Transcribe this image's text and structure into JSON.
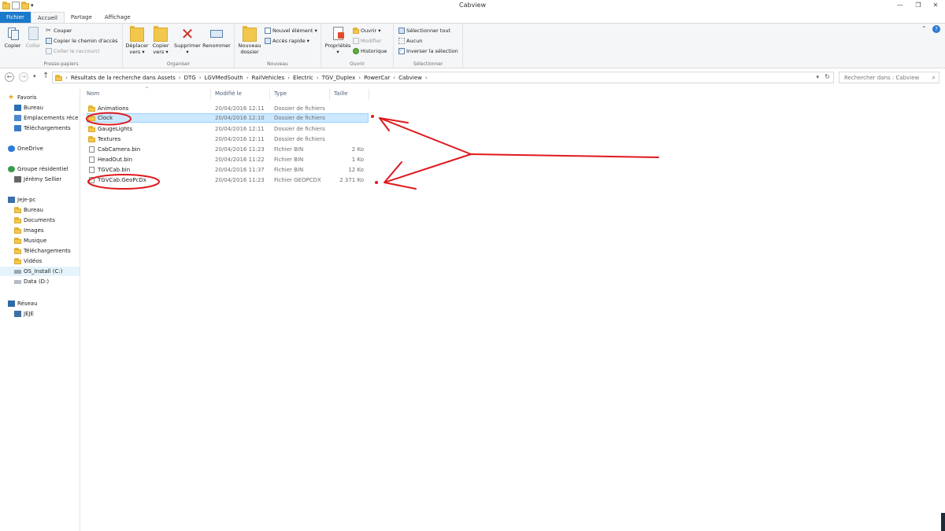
{
  "window": {
    "title": "Cabview"
  },
  "tabs": [
    {
      "label": "Fichier"
    },
    {
      "label": "Accueil"
    },
    {
      "label": "Partage"
    },
    {
      "label": "Affichage"
    }
  ],
  "ribbon": {
    "clipboard": {
      "label": "Presse-papiers",
      "copy": "Copier",
      "paste": "Coller",
      "cut": "Couper",
      "copy_path": "Copier le chemin d'accès",
      "paste_shortcut": "Coller le raccourci"
    },
    "organize": {
      "label": "Organiser",
      "move_to_line1": "Déplacer",
      "move_to_line2": "vers",
      "copy_to_line1": "Copier",
      "copy_to_line2": "vers",
      "delete": "Supprimer",
      "rename": "Renommer"
    },
    "new": {
      "label": "Nouveau",
      "new_folder_line1": "Nouveau",
      "new_folder_line2": "dossier",
      "new_item": "Nouvel élément",
      "easy_access": "Accès rapide"
    },
    "open": {
      "label": "Ouvrir",
      "properties": "Propriétés",
      "open": "Ouvrir",
      "edit": "Modifier",
      "history": "Historique"
    },
    "select": {
      "label": "Sélectionner",
      "select_all": "Sélectionner tout",
      "select_none": "Aucun",
      "invert": "Inverser la sélection"
    }
  },
  "address": {
    "crumbs": [
      "Résultats de la recherche dans Assets",
      "DTG",
      "LGVMedSouth",
      "RailVehicles",
      "Electric",
      "TGV_Duplex",
      "PowerCar",
      "Cabview"
    ],
    "search_placeholder": "Rechercher dans : Cabview"
  },
  "nav": {
    "favorites": "Favoris",
    "fav_items": [
      "Bureau",
      "Emplacements récents",
      "Téléchargements"
    ],
    "onedrive": "OneDrive",
    "homegroup": "Groupe résidentiel",
    "homegroup_user": "Jérémy Sellier",
    "pc": "Jeje-pc",
    "pc_items": [
      "Bureau",
      "Documents",
      "Images",
      "Musique",
      "Téléchargements",
      "Vidéos",
      "OS_Install (C:)",
      "Data (D:)"
    ],
    "network": "Réseau",
    "network_items": [
      "JEJE"
    ]
  },
  "columns": {
    "name": "Nom",
    "modified": "Modifié le",
    "type": "Type",
    "size": "Taille"
  },
  "files": [
    {
      "name": "Animations",
      "modified": "20/04/2016 12:11",
      "type": "Dossier de fichiers",
      "size": "",
      "kind": "folder"
    },
    {
      "name": "Clock",
      "modified": "20/04/2016 12:10",
      "type": "Dossier de fichiers",
      "size": "",
      "kind": "folder"
    },
    {
      "name": "GaugeLights",
      "modified": "20/04/2016 12:11",
      "type": "Dossier de fichiers",
      "size": "",
      "kind": "folder"
    },
    {
      "name": "Textures",
      "modified": "20/04/2016 12:11",
      "type": "Dossier de fichiers",
      "size": "",
      "kind": "folder"
    },
    {
      "name": "CabCamera.bin",
      "modified": "20/04/2016 11:23",
      "type": "Fichier BIN",
      "size": "2 Ko",
      "kind": "file"
    },
    {
      "name": "HeadOut.bin",
      "modified": "20/04/2016 11:22",
      "type": "Fichier BIN",
      "size": "1 Ko",
      "kind": "file"
    },
    {
      "name": "TGVCab.bin",
      "modified": "20/04/2016 11:37",
      "type": "Fichier BIN",
      "size": "12 Ko",
      "kind": "file"
    },
    {
      "name": "TGVCab.GeoPcDx",
      "modified": "20/04/2016 11:23",
      "type": "Fichier GEOPCDX",
      "size": "2 371 Ko",
      "kind": "file"
    }
  ],
  "colors": {
    "file_tab": "#1979ca",
    "selection": "#cce8ff",
    "annotation": "#e0191e",
    "folder": "#f2c84c"
  }
}
